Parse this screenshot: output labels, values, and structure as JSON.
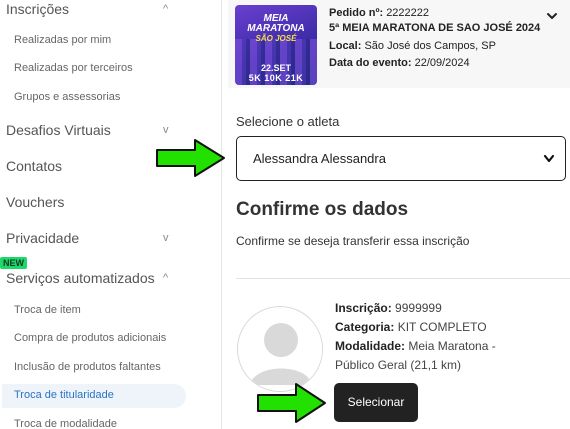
{
  "sidebar": {
    "sections": {
      "inscricoes": "Inscrições",
      "desafios": "Desafios Virtuais",
      "contatos": "Contatos",
      "vouchers": "Vouchers",
      "privacidade": "Privacidade",
      "servicos": "Serviços automatizados"
    },
    "inscricoes_items": [
      "Realizadas por mim",
      "Realizadas por terceiros",
      "Grupos e assessorias"
    ],
    "servicos_items": [
      "Troca de item",
      "Compra de produtos adicionais",
      "Inclusão de produtos faltantes",
      "Troca de titularidade",
      "Troca de modalidade"
    ],
    "new_badge": "NEW",
    "chevron_up": "^",
    "chevron_down": "v"
  },
  "event": {
    "thumb": {
      "title_line1": "MEIA",
      "title_line2": "MARATONA",
      "title_line3": "SÃO JOSÉ",
      "date": "22.SET",
      "distances": "5K 10K 21K"
    },
    "pedido_label": "Pedido nº:",
    "pedido_value": "2222222",
    "title": "5ª MEIA MARATONA DE SAO JOSÉ 2024",
    "local_label": "Local:",
    "local_value": "São José dos Campos, SP",
    "data_label": "Data do evento:",
    "data_value": "22/09/2024"
  },
  "form": {
    "select_label": "Selecione o atleta",
    "selected_athlete": "Alessandra Alessandra",
    "confirm_title": "Confirme os dados",
    "confirm_text": "Confirme se deseja transferir essa inscrição"
  },
  "inscription": {
    "inscricao_label": "Inscrição:",
    "inscricao_value": "9999999",
    "categoria_label": "Categoria:",
    "categoria_value": "KIT COMPLETO",
    "modalidade_label": "Modalidade:",
    "modalidade_value_1": "Meia Maratona -",
    "modalidade_value_2": "Público Geral (21,1 km)",
    "select_button": "Selecionar"
  },
  "colors": {
    "arrow_fill": "#22e000",
    "active_item_bg": "#eef4fa",
    "active_item_text": "#2a74c4",
    "button_bg": "#222222",
    "badge_bg": "#1fd86c"
  },
  "icons": [
    "chevron-up-icon",
    "chevron-down-icon",
    "avatar-placeholder-icon",
    "arrow-right-icon"
  ]
}
